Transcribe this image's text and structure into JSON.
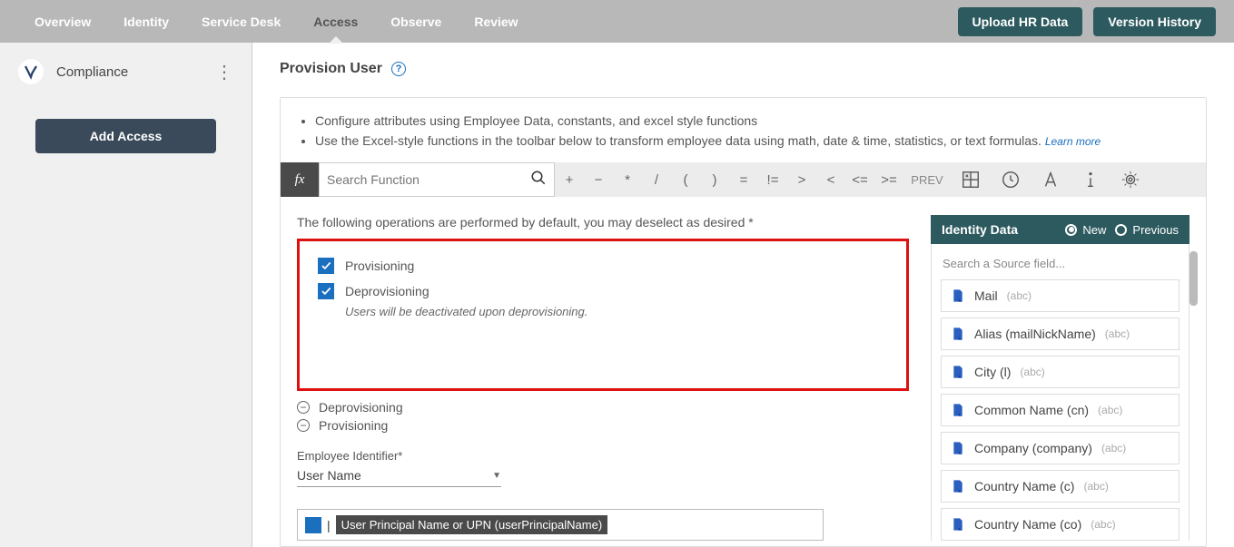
{
  "nav": {
    "tabs": [
      "Overview",
      "Identity",
      "Service Desk",
      "Access",
      "Observe",
      "Review"
    ],
    "activeIndex": 3,
    "uploadBtn": "Upload HR Data",
    "versionBtn": "Version History"
  },
  "sidebar": {
    "title": "Compliance",
    "addBtn": "Add Access"
  },
  "page": {
    "title": "Provision User"
  },
  "config": {
    "bullet1": "Configure attributes using Employee Data, constants, and excel style functions",
    "bullet2": "Use the Excel-style functions in the toolbar below to transform employee data using math, date & time, statistics, or text formulas.",
    "learnMore": "Learn more"
  },
  "fx": {
    "label": "fx",
    "searchPlaceholder": "Search Function",
    "ops": [
      "+",
      "−",
      "*",
      "/",
      "(",
      ")",
      "=",
      "!=",
      ">",
      "<",
      "<=",
      ">="
    ],
    "prev": "PREV"
  },
  "operations": {
    "label": "The following operations are performed by default, you may deselect as desired *",
    "provisioning": "Provisioning",
    "deprovisioning": "Deprovisioning",
    "deprovNote": "Users will be deactivated upon deprovisioning."
  },
  "sections": {
    "deprovisioning": "Deprovisioning",
    "provisioning": "Provisioning"
  },
  "employeeId": {
    "label": "Employee Identifier*",
    "value": "User Name"
  },
  "upn": {
    "text": "User Principal Name or UPN (userPrincipalName)"
  },
  "identity": {
    "title": "Identity Data",
    "new": "New",
    "previous": "Previous",
    "searchPlaceholder": "Search a Source field...",
    "fields": [
      {
        "name": "Mail",
        "type": "(abc)"
      },
      {
        "name": "Alias (mailNickName)",
        "type": "(abc)"
      },
      {
        "name": "City (l)",
        "type": "(abc)"
      },
      {
        "name": "Common Name (cn)",
        "type": "(abc)"
      },
      {
        "name": "Company (company)",
        "type": "(abc)"
      },
      {
        "name": "Country Name (c)",
        "type": "(abc)"
      },
      {
        "name": "Country Name (co)",
        "type": "(abc)"
      }
    ]
  }
}
